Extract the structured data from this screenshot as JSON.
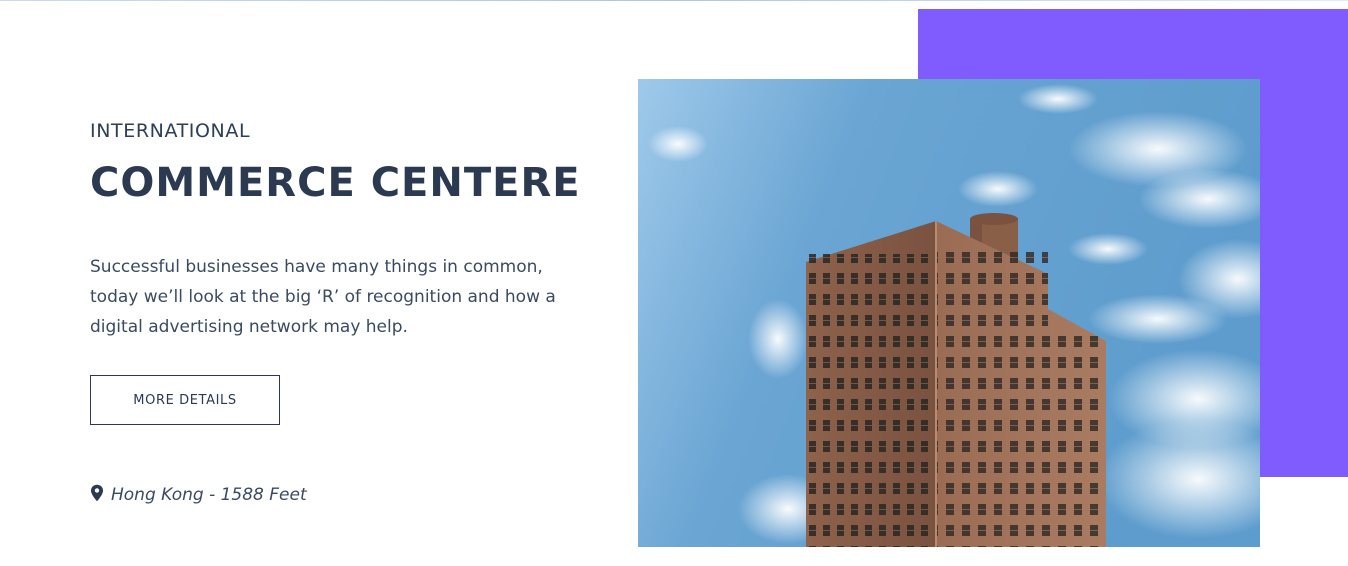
{
  "hero": {
    "eyebrow": "INTERNATIONAL",
    "title": "COMMERCE CENTERE",
    "description": "Successful businesses have many things in common, today we’ll look at the big ‘R’ of recognition and how a digital advertising network may help.",
    "button_label": "MORE DETAILS",
    "location_text": "Hong Kong - 1588 Feet",
    "location_icon": "map-pin-icon"
  },
  "colors": {
    "heading": "#2b3a50",
    "body_text": "#3b4a5f",
    "accent": "#805cff",
    "sky": "#6fa8d6",
    "brick": "#8a5a44"
  },
  "image": {
    "subject": "brick-building-photo"
  }
}
